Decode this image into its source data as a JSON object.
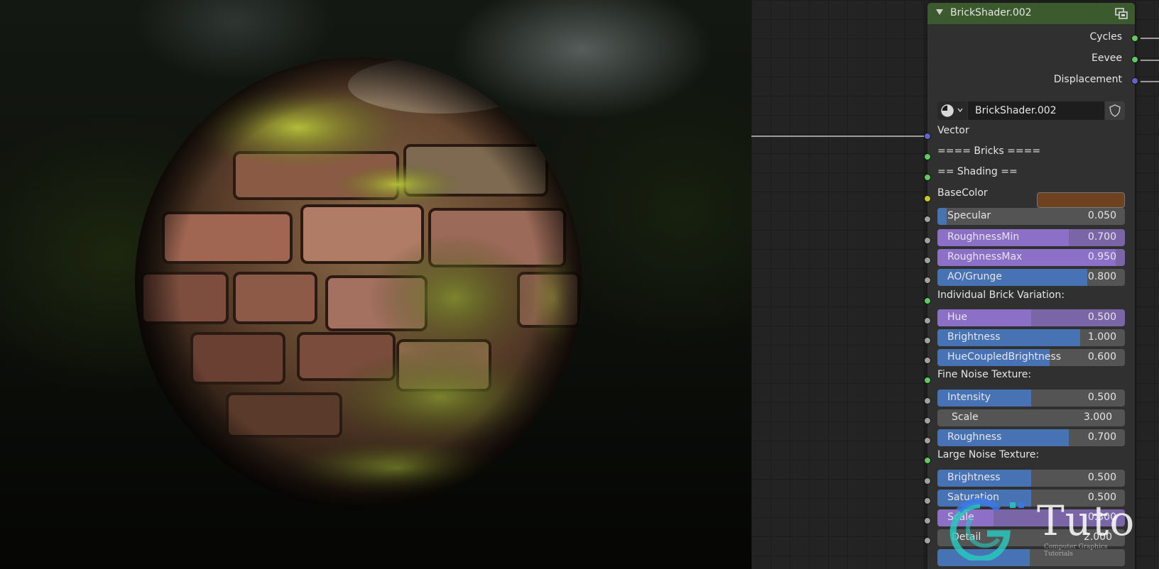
{
  "node": {
    "title": "BrickShader.002",
    "outputs": [
      {
        "label": "Cycles",
        "socket": "green"
      },
      {
        "label": "Eevee",
        "socket": "green"
      },
      {
        "label": "Displacement",
        "socket": "purple"
      }
    ],
    "datablock_name": "BrickShader.002",
    "vector_label": "Vector",
    "bricks_header": "==== Bricks ====",
    "shading_header": "== Shading ==",
    "basecolor_label": "BaseColor",
    "basecolor_value": "#6e4220",
    "individual_header": "Individual Brick Variation:",
    "fine_noise_header": "Fine Noise Texture:",
    "large_noise_header": "Large Noise Texture:",
    "shading_fields": [
      {
        "label": "Specular",
        "value": "0.050",
        "fraction": 0.05,
        "color": "blue"
      },
      {
        "label": "RoughnessMin",
        "value": "0.700",
        "fraction": 0.7,
        "color": "purple"
      },
      {
        "label": "RoughnessMax",
        "value": "0.950",
        "fraction": 0.95,
        "color": "purple"
      },
      {
        "label": "AO/Grunge",
        "value": "0.800",
        "fraction": 0.8,
        "color": "blue"
      }
    ],
    "individual_fields": [
      {
        "label": "Hue",
        "value": "0.500",
        "fraction": 0.5,
        "color": "purple"
      },
      {
        "label": "Brightness",
        "value": "1.000",
        "fraction": 0.76,
        "color": "blue"
      },
      {
        "label": "HueCoupledBrightness",
        "value": "0.600",
        "fraction": 0.6,
        "color": "blue"
      }
    ],
    "fine_noise_fields": [
      {
        "label": "Intensity",
        "value": "0.500",
        "fraction": 0.5,
        "color": "blue"
      },
      {
        "label": "Scale",
        "value": "3.000",
        "fraction": 0,
        "color": "none"
      },
      {
        "label": "Roughness",
        "value": "0.700",
        "fraction": 0.7,
        "color": "blue"
      }
    ],
    "large_noise_fields": [
      {
        "label": "Brightness",
        "value": "0.500",
        "fraction": 0.5,
        "color": "blue"
      },
      {
        "label": "Saturation",
        "value": "0.500",
        "fraction": 0.5,
        "color": "blue"
      },
      {
        "label": "Scale",
        "value": "0.300",
        "fraction": 0.3,
        "color": "purple"
      },
      {
        "label": "Detail",
        "value": "2.000",
        "fraction": 0,
        "color": "none"
      }
    ]
  },
  "colors": {
    "blue_fill": "#4772b3",
    "purple_fill": "#8c6fc7",
    "node_header": "#3b5a2d"
  },
  "watermark": {
    "brand": "Tuto",
    "tagline": "Computer Graphics Tutorials"
  }
}
